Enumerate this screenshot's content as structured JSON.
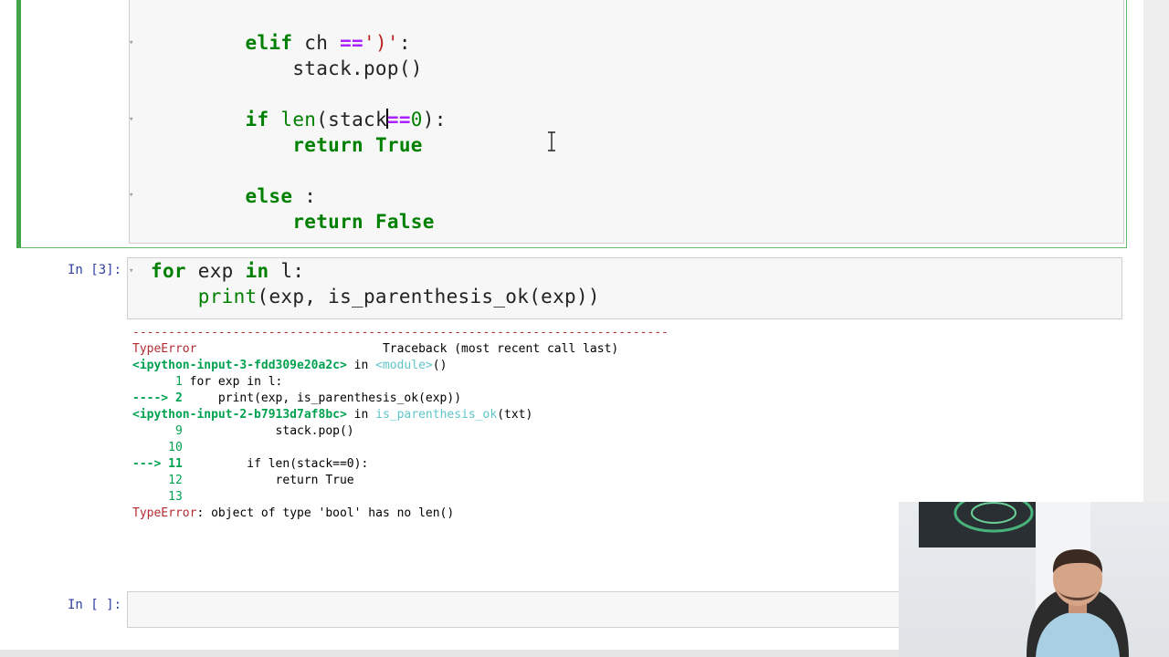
{
  "cells": [
    {
      "lines": [
        {
          "indent": "        ",
          "tokens": [
            [
              "kw",
              "elif"
            ],
            [
              "t",
              " ch "
            ],
            [
              "op",
              "=="
            ],
            [
              "str",
              "')'"
            ],
            [
              "t",
              ":"
            ]
          ]
        },
        {
          "indent": "            ",
          "tokens": [
            [
              "t",
              "stack.pop()"
            ]
          ]
        },
        {
          "indent": "",
          "tokens": []
        },
        {
          "indent": "        ",
          "tokens": [
            [
              "kw",
              "if"
            ],
            [
              "t",
              " "
            ],
            [
              "bi",
              "len"
            ],
            [
              "t",
              "(stack"
            ],
            [
              "caret",
              ""
            ],
            [
              "op",
              "=="
            ],
            [
              "num",
              "0"
            ],
            [
              "t",
              "):"
            ]
          ]
        },
        {
          "indent": "            ",
          "tokens": [
            [
              "kw",
              "return"
            ],
            [
              "t",
              " "
            ],
            [
              "kw",
              "True"
            ]
          ]
        },
        {
          "indent": "",
          "tokens": []
        },
        {
          "indent": "        ",
          "tokens": [
            [
              "kw",
              "else"
            ],
            [
              "t",
              " :"
            ]
          ]
        },
        {
          "indent": "            ",
          "tokens": [
            [
              "kw",
              "return"
            ],
            [
              "t",
              " "
            ],
            [
              "kw",
              "False"
            ]
          ]
        }
      ]
    },
    {
      "prompt": "In [3]:",
      "lines": [
        {
          "tokens": [
            [
              "kw",
              "for"
            ],
            [
              "t",
              " exp "
            ],
            [
              "kw",
              "in"
            ],
            [
              "t",
              " l:"
            ]
          ]
        },
        {
          "tokens": [
            [
              "t",
              "    "
            ],
            [
              "bi",
              "print"
            ],
            [
              "t",
              "(exp, is_parenthesis_ok(exp))"
            ]
          ]
        }
      ]
    },
    {
      "prompt": "In [ ]:"
    }
  ],
  "traceback": {
    "dashes": "---------------------------------------------------------------------------",
    "error_name": "TypeError",
    "header_right": "Traceback (most recent call last)",
    "frame1_file": "<ipython-input-3-fdd309e20a2c>",
    "frame1_in": " in ",
    "frame1_func": "<module>",
    "frame1_args": "()",
    "frame1_lines": [
      {
        "arrow": "      ",
        "num": "1",
        "code": " for exp in l:"
      },
      {
        "arrow": "----> ",
        "num": "2",
        "code": "     print(exp, is_parenthesis_ok(exp))"
      }
    ],
    "frame2_file": "<ipython-input-2-b7913d7af8bc>",
    "frame2_in": " in ",
    "frame2_func": "is_parenthesis_ok",
    "frame2_args": "(txt)",
    "frame2_lines": [
      {
        "arrow": "      ",
        "num": "9",
        "code": "             stack.pop()"
      },
      {
        "arrow": "     ",
        "num": "10",
        "code": ""
      },
      {
        "arrow": "---> ",
        "num": "11",
        "code": "         if len(stack==0):"
      },
      {
        "arrow": "     ",
        "num": "12",
        "code": "             return True"
      },
      {
        "arrow": "     ",
        "num": "13",
        "code": ""
      }
    ],
    "final_error": "TypeError",
    "final_message": ": object of type 'bool' has no len()"
  }
}
